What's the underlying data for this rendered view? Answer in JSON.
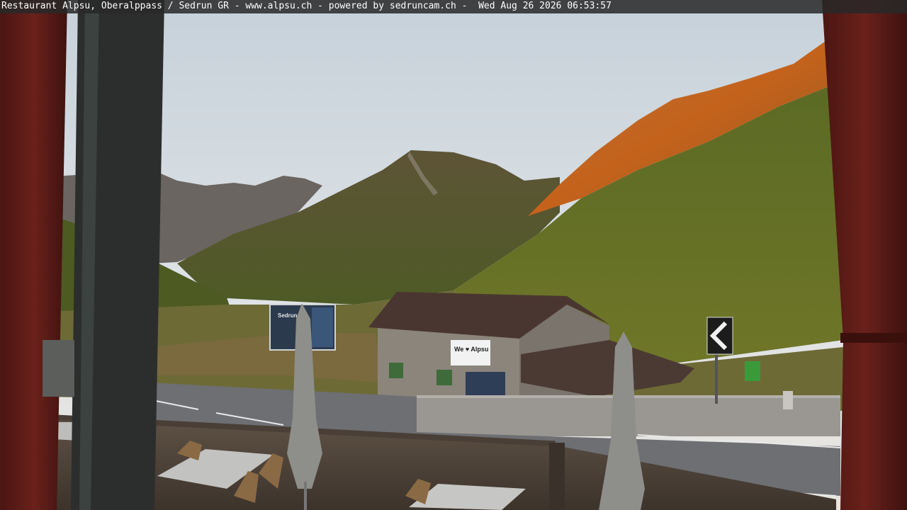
{
  "overlay": {
    "caption": "Restaurant Alpsu, Oberalppass / Sedrun GR - www.alpsu.ch - powered by sedruncam.ch -  Wed Aug 26 2026 06:53:57"
  },
  "signs": {
    "building_banner": "We ♥ Alpsu",
    "billboard": "Sedrun"
  },
  "colors": {
    "sky_top": "#c9d3dc",
    "sky_bottom": "#e3e6e8",
    "sunlit_ridge": "#c8651e",
    "meadow": "#5e6b22",
    "frame_red": "#5a1a16",
    "road": "#6c6e73"
  },
  "icons": {
    "road_sign": "chevron-left-icon"
  }
}
